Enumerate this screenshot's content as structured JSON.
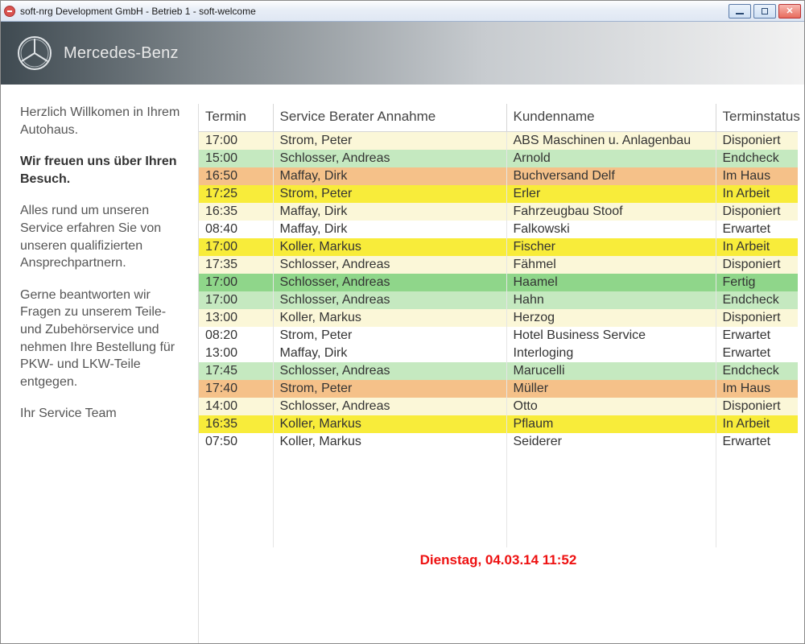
{
  "window": {
    "title": "soft-nrg Development GmbH - Betrieb 1 - soft-welcome"
  },
  "brand": {
    "name": "Mercedes-Benz"
  },
  "sidebar": {
    "p1": "Herzlich Willkomen in Ihrem Autohaus.",
    "p2": "Wir freuen uns über Ihren Besuch.",
    "p3": "Alles rund um unseren Service erfahren Sie von unseren qualifizierten Ansprechpartnern.",
    "p4": "Gerne beantworten wir Fragen zu unserem Teile- und Zubehörservice und nehmen Ihre Bestellung für PKW- und LKW-Teile entgegen.",
    "p5": "Ihr Service Team"
  },
  "table": {
    "headers": {
      "termin": "Termin",
      "advisor": "Service Berater Annahme",
      "customer": "Kundenname",
      "status": "Terminstatus"
    },
    "rows": [
      {
        "time": "17:00",
        "advisor": "Strom, Peter",
        "customer": "ABS Maschinen u. Anlagenbau",
        "status": "Disponiert",
        "cls": "row-cream"
      },
      {
        "time": "15:00",
        "advisor": "Schlosser, Andreas",
        "customer": "Arnold",
        "status": "Endcheck",
        "cls": "row-lightgreen"
      },
      {
        "time": "16:50",
        "advisor": "Maffay, Dirk",
        "customer": "Buchversand Delf",
        "status": "Im Haus",
        "cls": "row-orange"
      },
      {
        "time": "17:25",
        "advisor": "Strom, Peter",
        "customer": "Erler",
        "status": "In Arbeit",
        "cls": "row-yellow"
      },
      {
        "time": "16:35",
        "advisor": "Maffay, Dirk",
        "customer": "Fahrzeugbau Stoof",
        "status": "Disponiert",
        "cls": "row-cream"
      },
      {
        "time": "08:40",
        "advisor": "Maffay, Dirk",
        "customer": "Falkowski",
        "status": "Erwartet",
        "cls": "row-white"
      },
      {
        "time": "17:00",
        "advisor": "Koller, Markus",
        "customer": "Fischer",
        "status": "In Arbeit",
        "cls": "row-yellow"
      },
      {
        "time": "17:35",
        "advisor": "Schlosser, Andreas",
        "customer": "Fähmel",
        "status": "Disponiert",
        "cls": "row-cream"
      },
      {
        "time": "17:00",
        "advisor": "Schlosser, Andreas",
        "customer": "Haamel",
        "status": "Fertig",
        "cls": "row-green"
      },
      {
        "time": "17:00",
        "advisor": "Schlosser, Andreas",
        "customer": "Hahn",
        "status": "Endcheck",
        "cls": "row-lightgreen"
      },
      {
        "time": "13:00",
        "advisor": "Koller, Markus",
        "customer": "Herzog",
        "status": "Disponiert",
        "cls": "row-cream"
      },
      {
        "time": "08:20",
        "advisor": "Strom, Peter",
        "customer": "Hotel Business Service",
        "status": "Erwartet",
        "cls": "row-white"
      },
      {
        "time": "13:00",
        "advisor": "Maffay, Dirk",
        "customer": "Interloging",
        "status": "Erwartet",
        "cls": "row-white"
      },
      {
        "time": "17:45",
        "advisor": "Schlosser, Andreas",
        "customer": "Marucelli",
        "status": "Endcheck",
        "cls": "row-lightgreen"
      },
      {
        "time": "17:40",
        "advisor": "Strom, Peter",
        "customer": "Müller",
        "status": "Im Haus",
        "cls": "row-orange"
      },
      {
        "time": "14:00",
        "advisor": "Schlosser, Andreas",
        "customer": "Otto",
        "status": "Disponiert",
        "cls": "row-cream"
      },
      {
        "time": "16:35",
        "advisor": "Koller, Markus",
        "customer": "Pflaum",
        "status": "In Arbeit",
        "cls": "row-yellow"
      },
      {
        "time": "07:50",
        "advisor": "Koller, Markus",
        "customer": "Seiderer",
        "status": "Erwartet",
        "cls": "row-white"
      }
    ]
  },
  "footer": {
    "datetime": "Dienstag, 04.03.14 11:52"
  }
}
